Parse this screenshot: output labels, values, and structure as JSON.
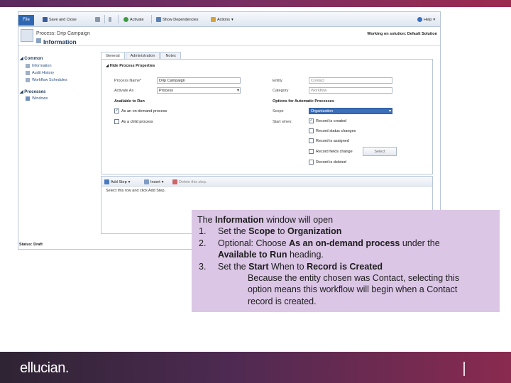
{
  "app": {
    "ribbon": {
      "file": "File",
      "save_close": "Save and Close",
      "activate": "Activate",
      "show_dependencies": "Show Dependencies",
      "actions": "Actions",
      "help": "Help"
    },
    "header": {
      "subtitle": "Process: Drip Campaign",
      "title": "Information",
      "solution": "Working on solution: Default Solution"
    },
    "nav": {
      "common": "Common",
      "common_items": [
        "Information",
        "Audit History",
        "Workflow Schedules"
      ],
      "processes": "Processes",
      "processes_items": [
        "Windows"
      ]
    },
    "tabs": [
      "General",
      "Administration",
      "Notes"
    ],
    "form": {
      "section": "Hide Process Properties",
      "process_name_label": "Process Name",
      "process_name_value": "Drip Campaign",
      "activate_as_label": "Activate As",
      "activate_as_value": "Process",
      "entity_label": "Entity",
      "entity_value": "Contact",
      "category_label": "Category",
      "category_value": "Workflow",
      "available_to_run": "Available to Run",
      "on_demand": "As an on-demand process",
      "child_process": "As a child process",
      "options_auto": "Options for Automatic Processes",
      "scope_label": "Scope",
      "scope_value": "Organization",
      "start_when_label": "Start when:",
      "start_options": [
        "Record is created",
        "Record status changes",
        "Record is assigned",
        "Record fields change",
        "Record is deleted"
      ],
      "select_button": "Select"
    },
    "steps": {
      "add_step": "Add Step",
      "insert": "Insert",
      "delete": "Delete this step.",
      "message": "Select this row and click Add Step."
    },
    "status": "Status: Draft"
  },
  "note": {
    "intro_pre": "The ",
    "intro_bold": "Information",
    "intro_post": " window will open",
    "item1_num": "1.",
    "item1_pre": "Set the ",
    "item1_bold1": "Scope",
    "item1_mid": " to ",
    "item1_bold2": "Organization",
    "item2_num": "2.",
    "item2_pre": "Optional: Choose ",
    "item2_bold": "As an on-demand process",
    "item2_post": " under the",
    "item2_line2_bold": "Available to Run",
    "item2_line2_post": " heading.",
    "item3_num": "3.",
    "item3_pre": "Set the ",
    "item3_bold1": "Start",
    "item3_mid": " When to ",
    "item3_bold2": "Record is Created",
    "detail_line1": "Because the entity chosen was Contact, selecting this",
    "detail_line2": "option means this workflow will begin when a Contact",
    "detail_line3": "record is created."
  },
  "footer": {
    "logo": "ellucian."
  },
  "colors": {
    "note_bg": "#dbc6e6",
    "brand_purple": "#5a2a5e",
    "brand_red": "#9c2a50"
  }
}
